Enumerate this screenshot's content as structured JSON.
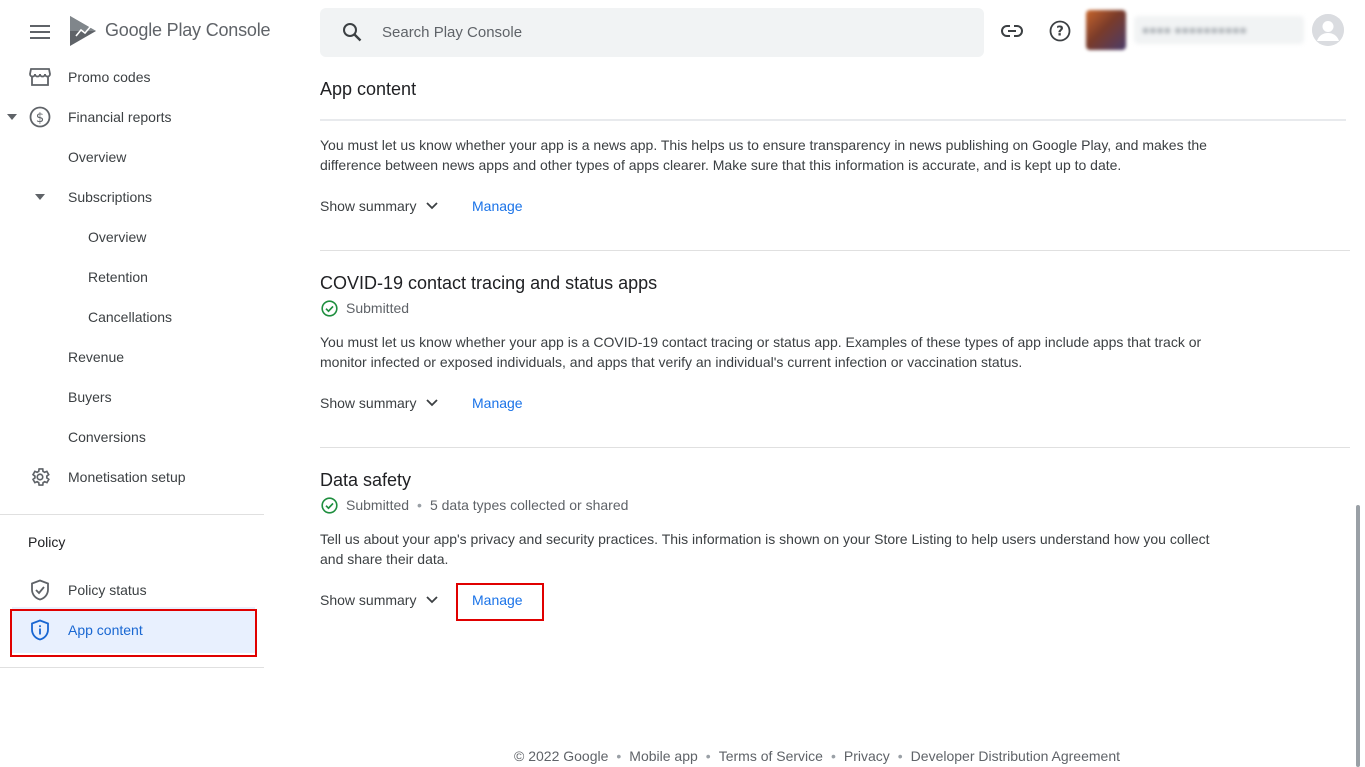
{
  "brand": {
    "google": "Google Play",
    "console": "Console"
  },
  "header": {
    "search_placeholder": "Search Play Console",
    "account_name": "●●●● ●●●●●●●●●●"
  },
  "sidebar": {
    "items": [
      {
        "label": "Promo codes"
      },
      {
        "label": "Financial reports"
      },
      {
        "label": "Overview"
      },
      {
        "label": "Subscriptions"
      },
      {
        "label": "Overview"
      },
      {
        "label": "Retention"
      },
      {
        "label": "Cancellations"
      },
      {
        "label": "Revenue"
      },
      {
        "label": "Buyers"
      },
      {
        "label": "Conversions"
      },
      {
        "label": "Monetisation setup"
      }
    ],
    "policy_title": "Policy",
    "policy_items": [
      {
        "label": "Policy status"
      },
      {
        "label": "App content"
      }
    ]
  },
  "main": {
    "page_title": "App content",
    "sections": [
      {
        "description": "You must let us know whether your app is a news app. This helps us to ensure transparency in news publishing on Google Play, and makes the difference between news apps and other types of apps clearer. Make sure that this information is accurate, and is kept up to date.",
        "show_summary": "Show summary",
        "manage": "Manage"
      },
      {
        "title": "COVID-19 contact tracing and status apps",
        "status": "Submitted",
        "description": "You must let us know whether your app is a COVID-19 contact tracing or status app. Examples of these types of app include apps that track or monitor infected or exposed individuals, and apps that verify an individual's current infection or vaccination status.",
        "show_summary": "Show summary",
        "manage": "Manage"
      },
      {
        "title": "Data safety",
        "status": "Submitted",
        "status_extra": "5 data types collected or shared",
        "description": "Tell us about your app's privacy and security practices. This information is shown on your Store Listing to help users understand how you collect and share their data.",
        "show_summary": "Show summary",
        "manage": "Manage"
      }
    ]
  },
  "footer": {
    "copyright": "© 2022 Google",
    "links": [
      "Mobile app",
      "Terms of Service",
      "Privacy",
      "Developer Distribution Agreement"
    ]
  },
  "colors": {
    "accent": "#1a73e8",
    "active_bg": "#e8f0fe",
    "success": "#1e8e3e",
    "highlight": "#e00000"
  }
}
